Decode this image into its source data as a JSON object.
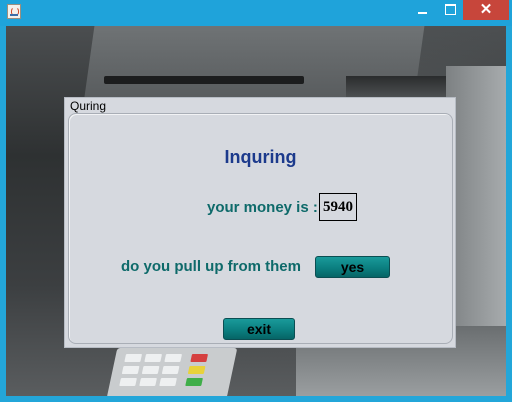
{
  "window": {
    "close_glyph": "✕"
  },
  "dialog": {
    "title": "Quring",
    "heading": "Inquring",
    "money_label": "your money is :",
    "money_value": "5940",
    "pull_label": "do you pull up from them",
    "yes_label": "yes",
    "exit_label": "exit"
  },
  "colors": {
    "titlebar": "#1fa3da",
    "close_button": "#c7463b",
    "heading": "#1c3a8c",
    "label_text": "#0e6a6a",
    "button": "#0b7f80"
  },
  "icons": {
    "app": "java-cup-icon",
    "minimize": "minimize-icon",
    "maximize": "maximize-icon",
    "close": "close-icon"
  }
}
